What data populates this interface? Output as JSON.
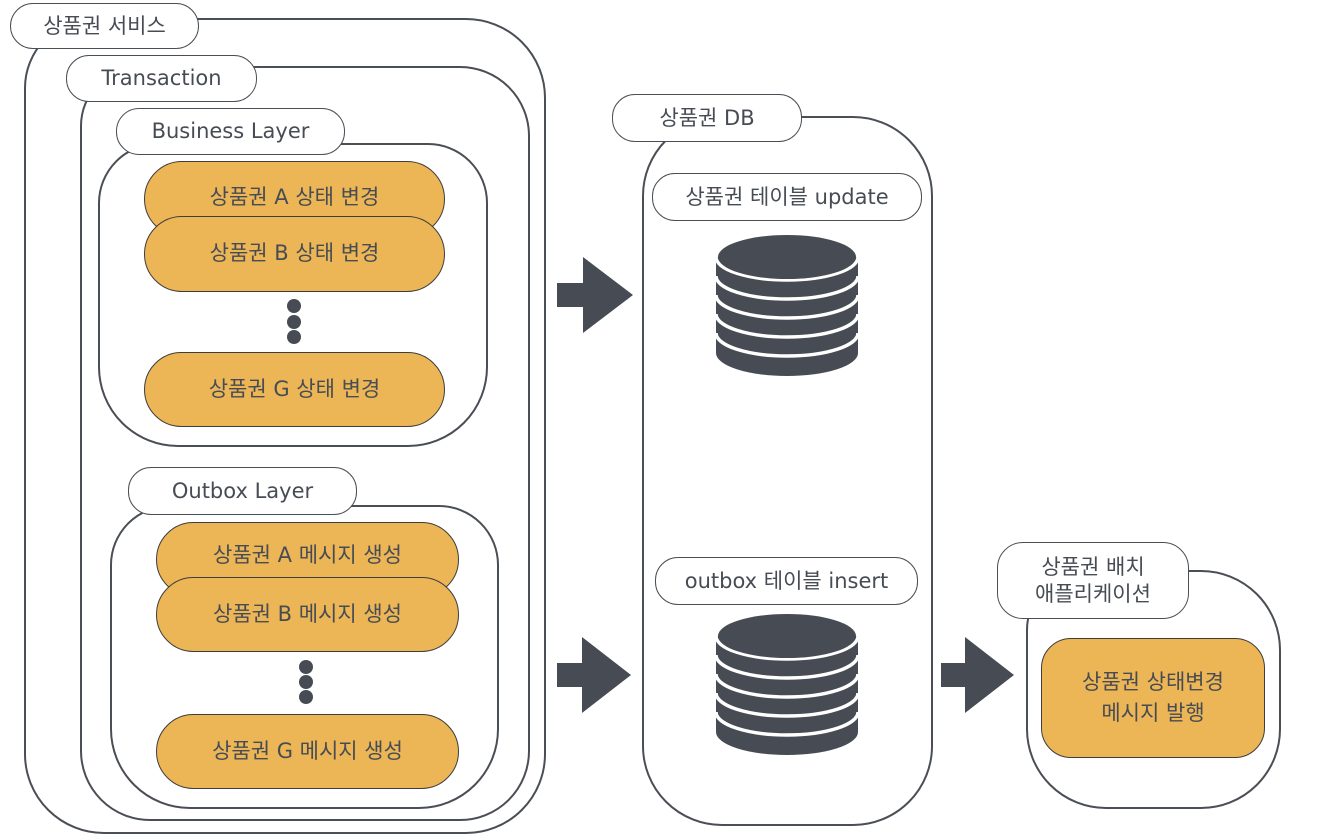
{
  "colors": {
    "stroke": "#4a4e55",
    "accent_fill": "#ecb556",
    "icon_fill": "#474c54",
    "text": "#474c54"
  },
  "service": {
    "label": "상품권 서비스",
    "transaction": {
      "label": "Transaction",
      "business_layer": {
        "label": "Business Layer",
        "items": [
          "상품권 A 상태 변경",
          "상품권 B 상태 변경",
          "상품권 G 상태 변경"
        ],
        "ellipsis_icon": "vertical-dots-icon"
      },
      "outbox_layer": {
        "label": "Outbox Layer",
        "items": [
          "상품권 A 메시지 생성",
          "상품권 B 메시지 생성",
          "상품권 G 메시지 생성"
        ],
        "ellipsis_icon": "vertical-dots-icon"
      }
    }
  },
  "database": {
    "label": "상품권 DB",
    "tables": [
      {
        "label": "상품권 테이블 update",
        "icon": "database-icon"
      },
      {
        "label": "outbox 테이블 insert",
        "icon": "database-icon"
      }
    ]
  },
  "batch": {
    "label_line1": "상품권 배치",
    "label_line2": "애플리케이션",
    "task_line1": "상품권 상태변경",
    "task_line2": "메시지 발행"
  },
  "arrows": [
    "right-arrow-icon",
    "right-arrow-icon",
    "right-arrow-icon"
  ]
}
